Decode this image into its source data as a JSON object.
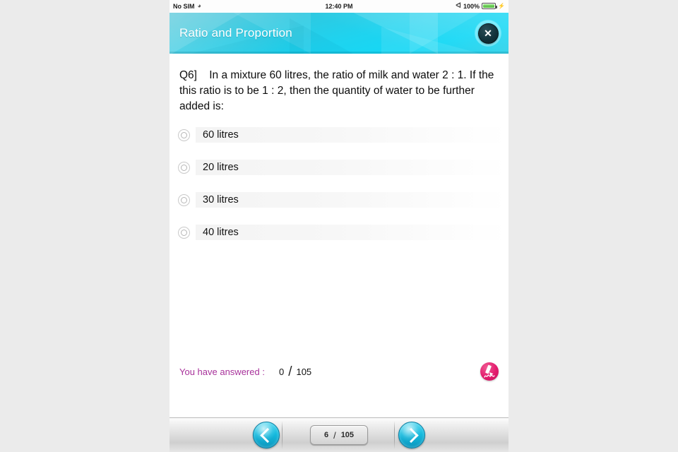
{
  "status_bar": {
    "carrier": "No SIM",
    "wifi_icon": "wifi-icon",
    "time": "12:40 PM",
    "bluetooth_icon": "bluetooth-icon",
    "battery_percent": "100%",
    "battery_icon": "battery-icon",
    "charging_icon": "charging-plug-icon"
  },
  "header": {
    "title": "Ratio and Proportion",
    "close_icon": "close-icon",
    "accent_color": "#1fd3ef"
  },
  "question": {
    "text": "Q6]    In a mixture 60 litres, the ratio of milk and water 2 : 1. If the this ratio is to be 1 : 2, then the quantity of water to be further added is:",
    "options": [
      {
        "label": "60 litres",
        "selected": false
      },
      {
        "label": "20 litres",
        "selected": false
      },
      {
        "label": "30 litres",
        "selected": false
      },
      {
        "label": "40 litres",
        "selected": false
      }
    ]
  },
  "answered": {
    "label": "You have answered :",
    "count": "0",
    "separator": "/",
    "total": "105",
    "label_color": "#a8329b",
    "badge_icon": "pen-signature-icon",
    "badge_color": "#e31b6d"
  },
  "toolbar": {
    "prev_icon": "chevron-left-icon",
    "next_icon": "chevron-right-icon",
    "page_current": "6",
    "page_separator": "/",
    "page_total": "105",
    "button_color": "#14b9dd"
  }
}
